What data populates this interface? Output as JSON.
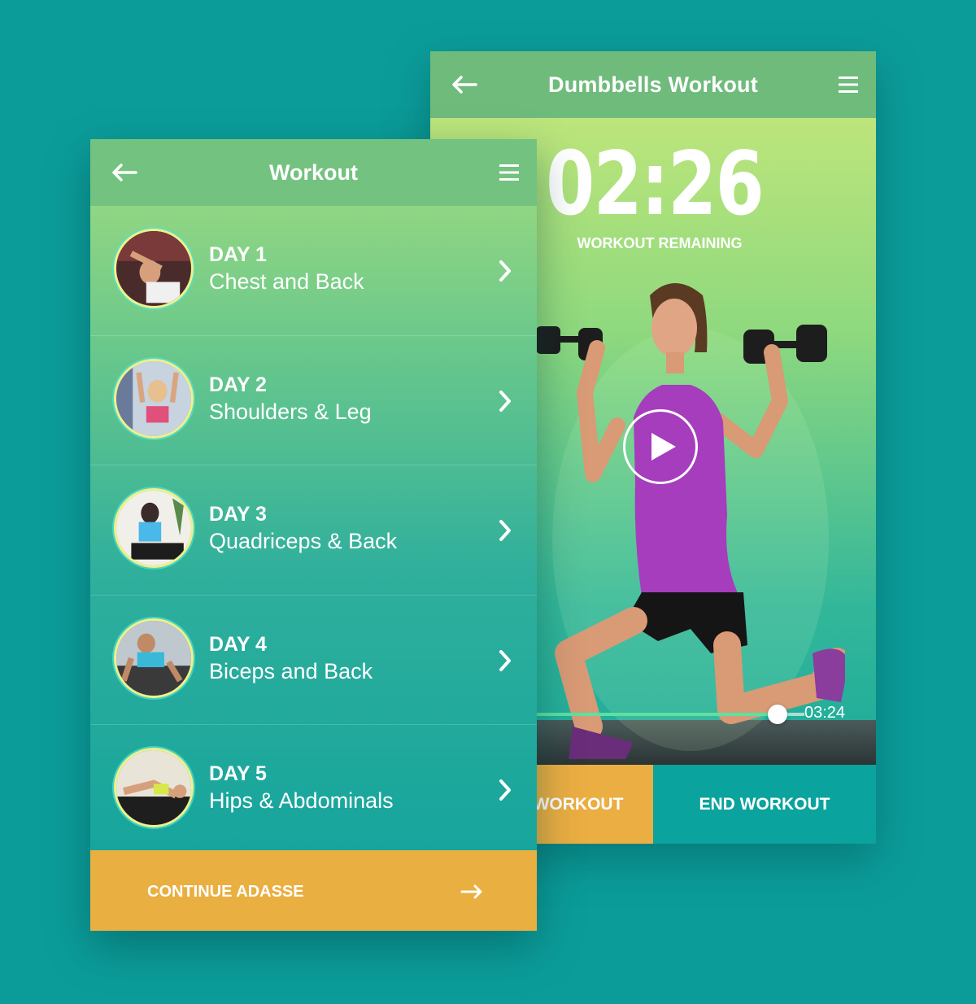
{
  "player": {
    "title": "Dumbbells Workout",
    "timer": "02:26",
    "timer_label": "WORKOUT REMAINING",
    "progress_fraction": 0.9,
    "total_time": "03:24",
    "left_button_label": "WORKOUT",
    "end_button_label": "END WORKOUT",
    "icons": [
      "back-arrow-icon",
      "hamburger-menu-icon",
      "play-icon"
    ]
  },
  "workout": {
    "title": "Workout",
    "items": [
      {
        "day": "DAY 1",
        "name": "Chest and Back"
      },
      {
        "day": "DAY 2",
        "name": "Shoulders &  Leg"
      },
      {
        "day": "DAY 3",
        "name": "Quadriceps & Back"
      },
      {
        "day": "DAY 4",
        "name": "Biceps and Back"
      },
      {
        "day": "DAY 5",
        "name": "Hips & Abdominals"
      }
    ],
    "continue_label": "CONTINUE ADASSE",
    "icons": [
      "back-arrow-icon",
      "hamburger-menu-icon",
      "chevron-right-icon",
      "arrow-right-icon"
    ]
  },
  "colors": {
    "background": "#0b9c9a",
    "accent_orange": "#eaaf41",
    "header_green": "#74c27f",
    "teal": "#0ba39d"
  }
}
